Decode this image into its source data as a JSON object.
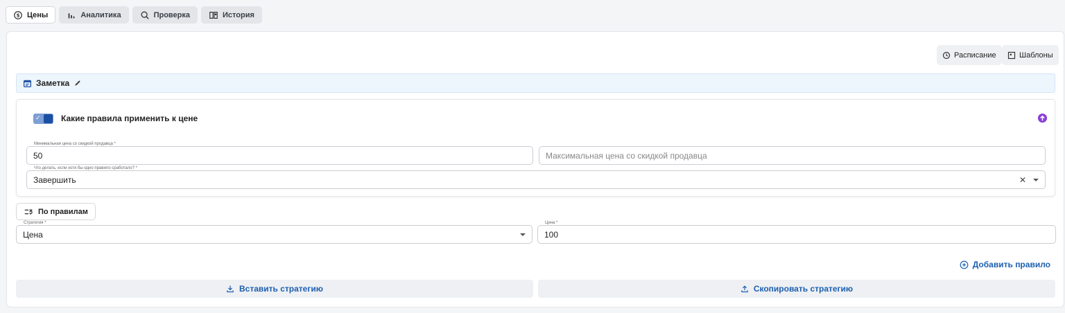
{
  "tabs": [
    {
      "label": "Цены",
      "icon": "price-cycle-icon",
      "active": true
    },
    {
      "label": "Аналитика",
      "icon": "bar-chart-icon",
      "active": false
    },
    {
      "label": "Проверка",
      "icon": "search-icon",
      "active": false
    },
    {
      "label": "История",
      "icon": "history-book-icon",
      "active": false
    }
  ],
  "toolbar": {
    "schedule_label": "Расписание",
    "templates_label": "Шаблоны"
  },
  "note": {
    "label": "Заметка"
  },
  "rules": {
    "title": "Какие правила применить к цене",
    "min_price": {
      "label": "Минимальная цена со скидкой продавца *",
      "value": "50"
    },
    "max_price": {
      "placeholder": "Максимальная цена со скидкой продавца"
    },
    "action": {
      "label": "Что делать, если хотя бы одно правило сработало? *",
      "value": "Завершить"
    }
  },
  "by_rules_label": "По правилам",
  "strategy": {
    "label": "Стратегия *",
    "value": "Цена"
  },
  "price": {
    "label": "Цена *",
    "value": "100"
  },
  "add_rule_label": "Добавить правило",
  "insert_strategy_label": "Вставить стратегию",
  "copy_strategy_label": "Скопировать стратегию",
  "colors": {
    "accent": "#1c5fb0",
    "toggle": "#1b4fa3",
    "up_icon": "#8b3fd9",
    "note_bg": "#edf5fd"
  }
}
